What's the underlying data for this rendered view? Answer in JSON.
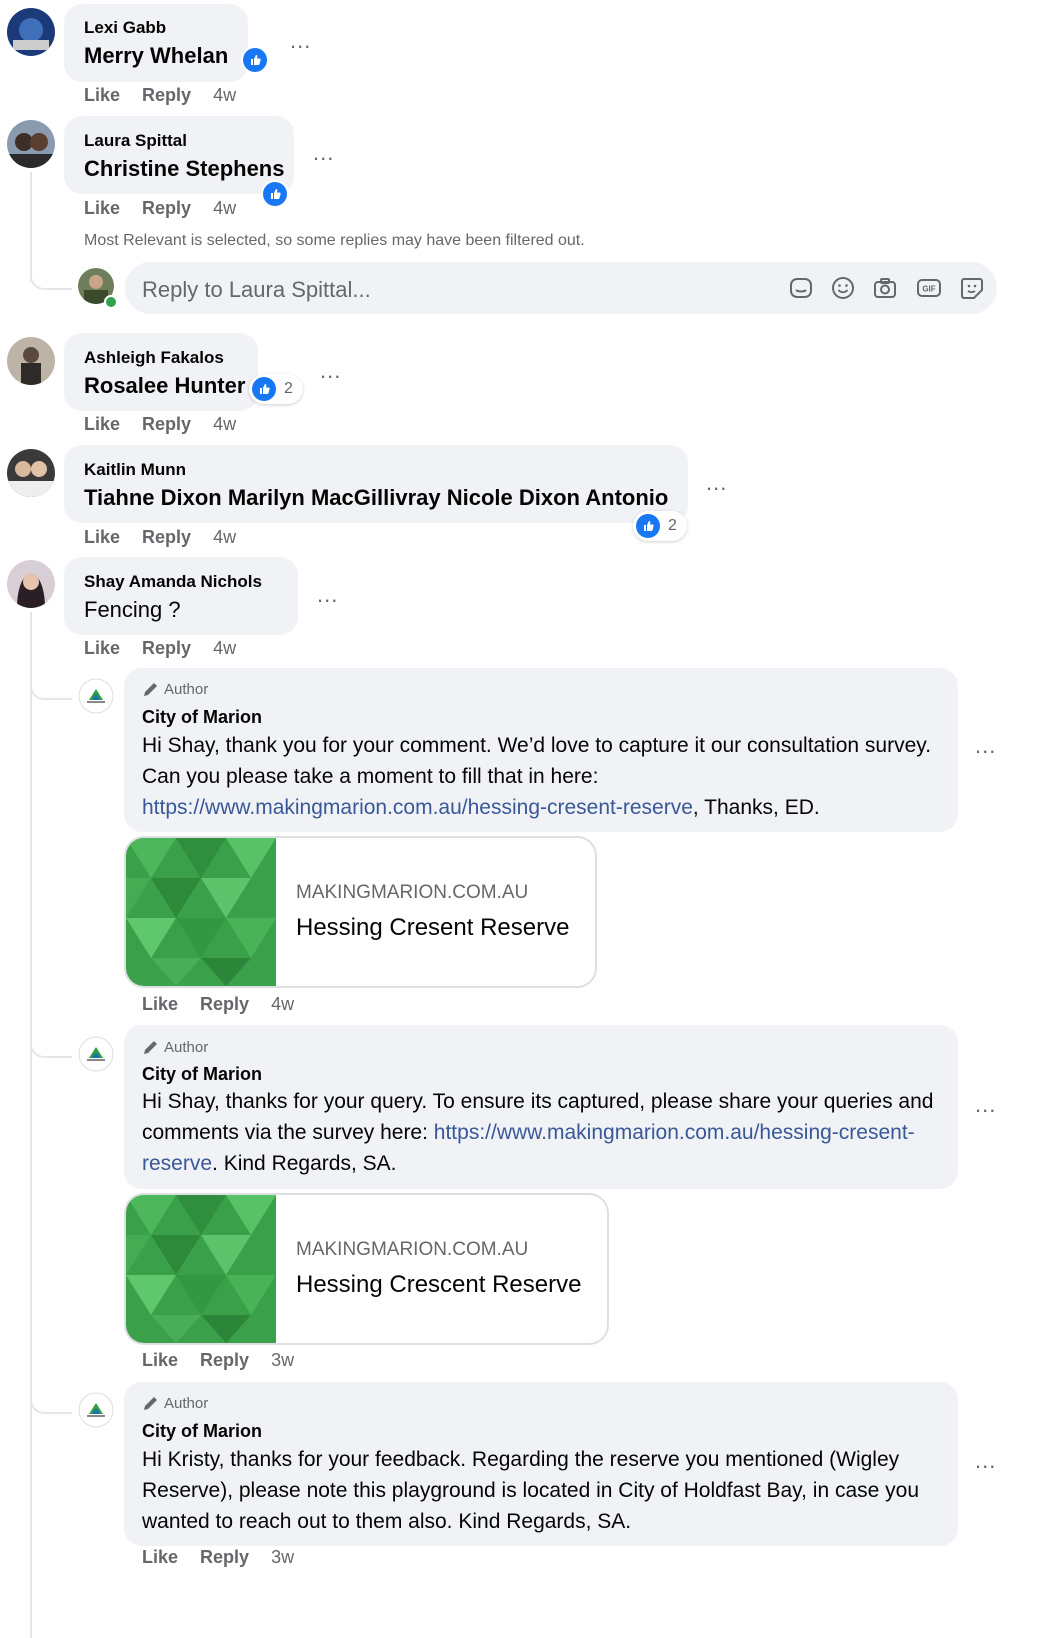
{
  "comments": [
    {
      "author": "Lexi Gabb",
      "text": "Merry Whelan",
      "actions": {
        "like": "Like",
        "reply": "Reply",
        "time": "4w"
      }
    },
    {
      "author": "Laura Spittal",
      "text": "Christine Stephens",
      "actions": {
        "like": "Like",
        "reply": "Reply",
        "time": "4w"
      },
      "notice": "Most Relevant is selected, so some replies may have been filtered out.",
      "reply_placeholder": "Reply to Laura Spittal..."
    },
    {
      "author": "Ashleigh Fakalos",
      "text": "Rosalee Hunter",
      "reaction_count": "2",
      "actions": {
        "like": "Like",
        "reply": "Reply",
        "time": "4w"
      }
    },
    {
      "author": "Kaitlin Munn",
      "text": "Tiahne Dixon Marilyn MacGillivray Nicole Dixon Antonio",
      "reaction_count": "2",
      "actions": {
        "like": "Like",
        "reply": "Reply",
        "time": "4w"
      }
    },
    {
      "author": "Shay Amanda Nichols",
      "text": "Fencing ?",
      "actions": {
        "like": "Like",
        "reply": "Reply",
        "time": "4w"
      }
    }
  ],
  "replies": [
    {
      "badge": "Author",
      "page": "City of Marion",
      "text_before": "Hi Shay, thank you for your comment. We’d love to capture it our consultation survey. Can you please take a moment to fill that in here: ",
      "link": "https://www.makingmarion.com.au/hessing-cresent-reserve",
      "text_after": ", Thanks, ED.",
      "preview": {
        "domain": "MAKINGMARION.COM.AU",
        "title": "Hessing Cresent Reserve"
      },
      "actions": {
        "like": "Like",
        "reply": "Reply",
        "time": "4w"
      }
    },
    {
      "badge": "Author",
      "page": "City of Marion",
      "text_before": "Hi Shay, thanks for your query. To ensure its captured, please share your queries and comments via the survey here: ",
      "link": "https://www.makingmarion.com.au/hessing-cresent-reserve",
      "text_after": ". Kind Regards, SA.",
      "preview": {
        "domain": "MAKINGMARION.COM.AU",
        "title": "Hessing Crescent Reserve"
      },
      "actions": {
        "like": "Like",
        "reply": "Reply",
        "time": "3w"
      }
    },
    {
      "badge": "Author",
      "page": "City of Marion",
      "text_before": "Hi Kristy, thanks for your feedback. Regarding the reserve you mentioned (Wigley Reserve), please note this playground is located in City of Holdfast Bay, in case you wanted to reach out to them also. Kind Regards, SA.",
      "actions": {
        "like": "Like",
        "reply": "Reply",
        "time": "3w"
      }
    }
  ],
  "more_options": "...",
  "colors": {
    "accent": "#1877f2",
    "bubble": "#f0f2f5",
    "muted": "#65676b",
    "link": "#385898"
  }
}
